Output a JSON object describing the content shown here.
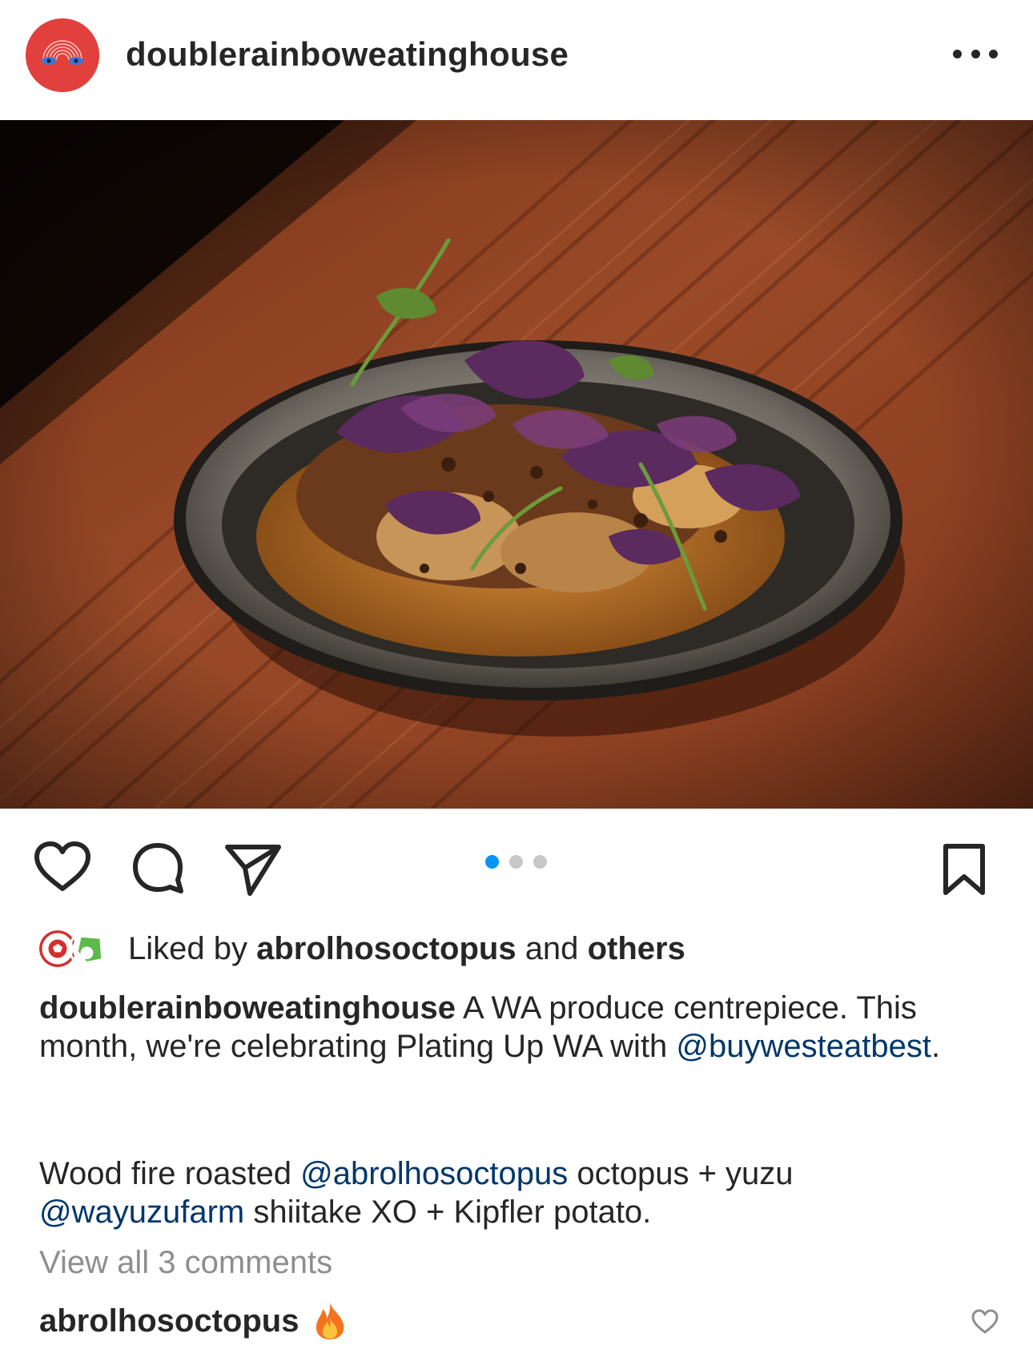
{
  "post": {
    "username": "doublerainboweatinghouse",
    "image_alt": "Plated octopus dish with purple shiso on a wooden table",
    "carousel_total": 3,
    "carousel_index": 1
  },
  "likes": {
    "prefix": "Liked by",
    "user": "abrolhosoctopus",
    "conjunction": "and",
    "suffix": "others"
  },
  "caption": {
    "username": "doublerainboweatinghouse",
    "text1": "A WA produce centrepiece. This month, we're celebrating Plating Up WA with",
    "mention1": "@buywesteatbest",
    "period": ".",
    "line2_a": "Wood fire roasted",
    "mention2": "@abrolhosoctopus",
    "line2_b": "octopus + yuzu",
    "mention3": "@wayuzufarm",
    "line2_c": "shiitake XO + Kipfler potato."
  },
  "comments": {
    "view_all": "View all 3 comments",
    "first_user": "abrolhosoctopus",
    "first_text_icon": "fire-emoji"
  },
  "colors": {
    "accent_blue": "#0095f6",
    "mention": "#00376b",
    "avatar_red": "#e2403c",
    "muted": "#8e8e8e"
  }
}
